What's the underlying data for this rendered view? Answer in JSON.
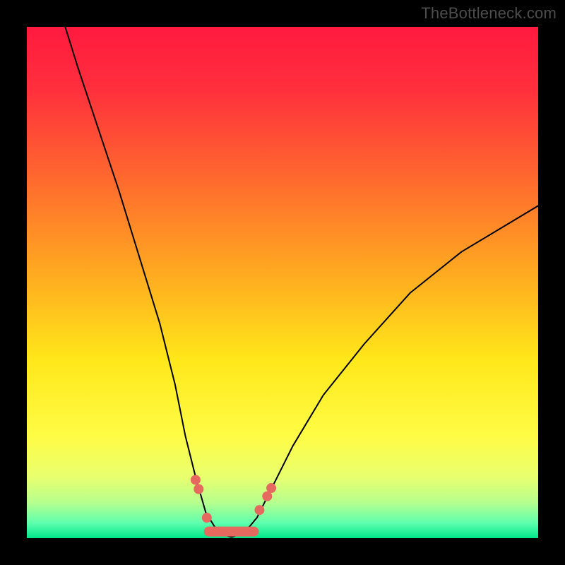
{
  "watermark": "TheBottleneck.com",
  "chart_data": {
    "type": "line",
    "title": "",
    "xlabel": "",
    "ylabel": "",
    "xlim": [
      0,
      100
    ],
    "ylim": [
      0,
      100
    ],
    "grid": false,
    "legend": false,
    "background_gradient_stops": [
      {
        "offset": 0.0,
        "color": "#ff1a3f"
      },
      {
        "offset": 0.12,
        "color": "#ff2f3d"
      },
      {
        "offset": 0.3,
        "color": "#ff6a2e"
      },
      {
        "offset": 0.5,
        "color": "#ffb01f"
      },
      {
        "offset": 0.65,
        "color": "#ffe71a"
      },
      {
        "offset": 0.8,
        "color": "#fffc45"
      },
      {
        "offset": 0.88,
        "color": "#e9ff6e"
      },
      {
        "offset": 0.93,
        "color": "#b7ff8e"
      },
      {
        "offset": 0.97,
        "color": "#5fffae"
      },
      {
        "offset": 1.0,
        "color": "#00e58a"
      }
    ],
    "series": [
      {
        "name": "bottleneck-curve",
        "stroke": "#000000",
        "stroke_width": 2,
        "points": [
          {
            "x": 7.5,
            "y": 100.0
          },
          {
            "x": 10.0,
            "y": 92.0
          },
          {
            "x": 14.0,
            "y": 80.0
          },
          {
            "x": 18.0,
            "y": 68.0
          },
          {
            "x": 22.0,
            "y": 55.0
          },
          {
            "x": 26.0,
            "y": 42.0
          },
          {
            "x": 29.0,
            "y": 30.0
          },
          {
            "x": 31.0,
            "y": 20.0
          },
          {
            "x": 33.0,
            "y": 12.0
          },
          {
            "x": 35.0,
            "y": 5.0
          },
          {
            "x": 37.5,
            "y": 1.0
          },
          {
            "x": 40.0,
            "y": 0.2
          },
          {
            "x": 42.5,
            "y": 1.0
          },
          {
            "x": 45.0,
            "y": 4.0
          },
          {
            "x": 48.0,
            "y": 10.0
          },
          {
            "x": 52.0,
            "y": 18.0
          },
          {
            "x": 58.0,
            "y": 28.0
          },
          {
            "x": 66.0,
            "y": 38.0
          },
          {
            "x": 75.0,
            "y": 48.0
          },
          {
            "x": 85.0,
            "y": 56.0
          },
          {
            "x": 95.0,
            "y": 62.0
          },
          {
            "x": 100.0,
            "y": 65.0
          }
        ]
      },
      {
        "name": "valley-marker-left",
        "type": "scatter",
        "stroke": "#e6695f",
        "fill": "#e6695f",
        "radius": 7,
        "points": [
          {
            "x": 33.0,
            "y": 11.4
          },
          {
            "x": 33.6,
            "y": 9.6
          },
          {
            "x": 35.2,
            "y": 4.0
          }
        ]
      },
      {
        "name": "valley-marker-right",
        "type": "scatter",
        "stroke": "#e6695f",
        "fill": "#e6695f",
        "radius": 7,
        "points": [
          {
            "x": 45.5,
            "y": 5.5
          },
          {
            "x": 47.0,
            "y": 8.2
          },
          {
            "x": 47.8,
            "y": 9.8
          }
        ]
      },
      {
        "name": "valley-floor-band",
        "type": "line",
        "stroke": "#e6695f",
        "stroke_width": 14,
        "points": [
          {
            "x": 35.6,
            "y": 1.3
          },
          {
            "x": 44.4,
            "y": 1.3
          }
        ]
      }
    ]
  }
}
